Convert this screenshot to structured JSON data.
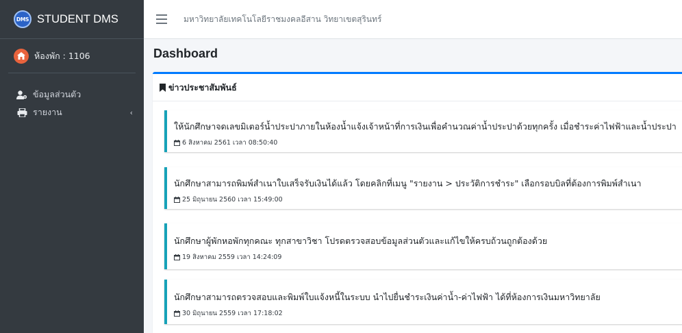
{
  "brand": {
    "logo_text": "DMS",
    "name": "STUDENT DMS"
  },
  "user_panel": {
    "room_label": "ห้องพัก : 1106"
  },
  "nav": {
    "items": [
      {
        "label": "ข้อมูลส่วนตัว",
        "icon": "user-cog-icon"
      },
      {
        "label": "รายงาน",
        "icon": "printer-icon",
        "chevron": "‹"
      }
    ]
  },
  "topbar": {
    "title": "มหาวิทยาลัยเทคโนโลยีราชมงคลอีสาน วิทยาเขตสุรินทร์"
  },
  "page": {
    "title": "Dashboard"
  },
  "news_card": {
    "title": "ข่าวประชาสัมพันธ์",
    "items": [
      {
        "text": "ให้นักศึกษาจดเลขมิเตอร์น้ำประปาภายในห้องน้ำแจ้งเจ้าหน้าที่การเงินเพื่อคำนวณค่าน้ำประปาด้วยทุกครั้ง เมื่อชำระค่าไฟฟ้าและน้ำประปา",
        "date": "6 สิงหาคม 2561 เวลา 08:50:40"
      },
      {
        "text": "นักศึกษาสามารถพิมพ์สำเนาใบเสร็จรับเงินได้แล้ว โดยคลิกที่เมนู \"รายงาน > ประวัติการชำระ\" เลือกรอบบิลที่ต้องการพิมพ์สำเนา",
        "date": "25 มิถุนายน 2560 เวลา 15:49:00"
      },
      {
        "text": "นักศึกษาผู้พักหอพักทุกคณะ ทุกสาขาวิชา โปรดตรวจสอบข้อมูลส่วนตัวและแก้ไขให้ครบถ้วนถูกต้องด้วย",
        "date": "19 สิงหาคม 2559 เวลา 14:24:09"
      },
      {
        "text": "นักศึกษาสามารถตรวจสอบและพิมพ์ใบแจ้งหนี้ในระบบ นำไปยื่นชำระเงินค่าน้ำ-ค่าไฟฟ้า ได้ที่ห้องการเงินมหาวิทยาลัย",
        "date": "30 มิถุนายน 2559 เวลา 17:18:02"
      }
    ]
  },
  "colors": {
    "sidebar_bg": "#343a40",
    "card_accent": "#007bff",
    "news_accent": "#17a2b8",
    "room_icon": "#e8633d"
  }
}
